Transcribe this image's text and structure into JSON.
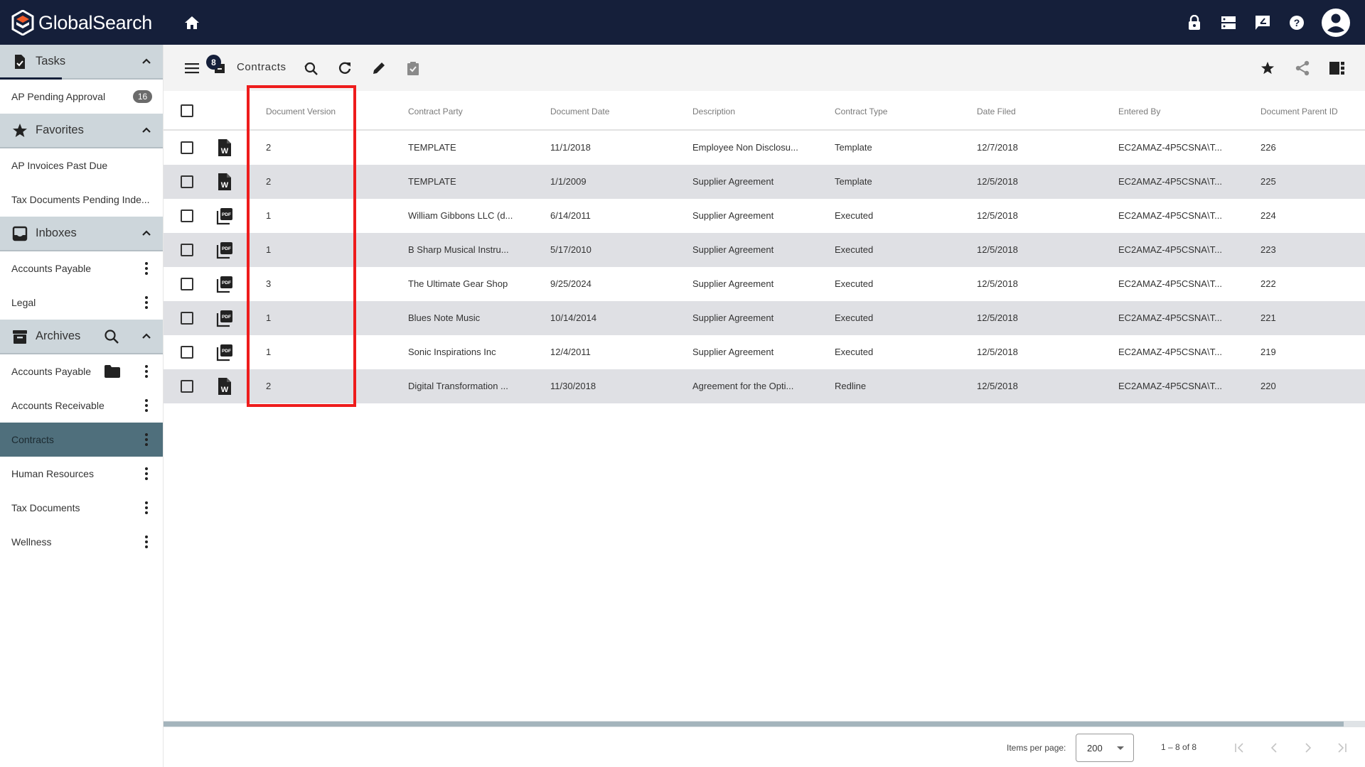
{
  "app": {
    "title": "GlobalSearch",
    "brand_color": "#151f3a",
    "accent_color": "#f05a28"
  },
  "topbar": {
    "icons": [
      "home-icon",
      "lock-icon",
      "server-icon",
      "feedback-icon",
      "help-icon",
      "account-icon"
    ]
  },
  "sidebar": {
    "sections": [
      {
        "label": "Tasks",
        "icon": "task-icon",
        "items": [
          {
            "label": "AP Pending Approval",
            "badge": "16"
          }
        ]
      },
      {
        "label": "Favorites",
        "icon": "star-icon",
        "items": [
          {
            "label": "AP Invoices Past Due"
          },
          {
            "label": "Tax Documents Pending Inde..."
          }
        ]
      },
      {
        "label": "Inboxes",
        "icon": "inbox-icon",
        "items": [
          {
            "label": "Accounts Payable"
          },
          {
            "label": "Legal"
          }
        ]
      },
      {
        "label": "Archives",
        "icon": "archive-icon",
        "items": [
          {
            "label": "Accounts Payable"
          },
          {
            "label": "Accounts Receivable"
          },
          {
            "label": "Contracts",
            "selected": true
          },
          {
            "label": "Human Resources"
          },
          {
            "label": "Tax Documents"
          },
          {
            "label": "Wellness"
          }
        ]
      }
    ]
  },
  "toolbar": {
    "title": "Contracts",
    "count_badge": "8",
    "icons": [
      "menu-icon",
      "archive-count-icon",
      "search-refresh-icon",
      "refresh-icon",
      "edit-icon",
      "approve-icon",
      "favorite-star-icon",
      "share-icon",
      "view-columns-icon"
    ]
  },
  "table": {
    "columns": [
      "Document Version",
      "Contract Party",
      "Document Date",
      "Description",
      "Contract Type",
      "Date Filed",
      "Entered By",
      "Document Parent ID"
    ],
    "rows": [
      {
        "file_type": "word",
        "version": "2",
        "party": "TEMPLATE",
        "doc_date": "11/1/2018",
        "description": "Employee Non Disclosu...",
        "type": "Template",
        "date_filed": "12/7/2018",
        "entered_by": "EC2AMAZ-4P5CSNA\\T...",
        "parent_id": "226"
      },
      {
        "file_type": "word",
        "version": "2",
        "party": "TEMPLATE",
        "doc_date": "1/1/2009",
        "description": "Supplier Agreement",
        "type": "Template",
        "date_filed": "12/5/2018",
        "entered_by": "EC2AMAZ-4P5CSNA\\T...",
        "parent_id": "225"
      },
      {
        "file_type": "pdf",
        "version": "1",
        "party": "William Gibbons LLC (d...",
        "doc_date": "6/14/2011",
        "description": "Supplier Agreement",
        "type": "Executed",
        "date_filed": "12/5/2018",
        "entered_by": "EC2AMAZ-4P5CSNA\\T...",
        "parent_id": "224"
      },
      {
        "file_type": "pdf",
        "version": "1",
        "party": "B Sharp Musical Instru...",
        "doc_date": "5/17/2010",
        "description": "Supplier Agreement",
        "type": "Executed",
        "date_filed": "12/5/2018",
        "entered_by": "EC2AMAZ-4P5CSNA\\T...",
        "parent_id": "223"
      },
      {
        "file_type": "pdf",
        "version": "3",
        "party": "The Ultimate Gear Shop",
        "doc_date": "9/25/2024",
        "description": "Supplier Agreement",
        "type": "Executed",
        "date_filed": "12/5/2018",
        "entered_by": "EC2AMAZ-4P5CSNA\\T...",
        "parent_id": "222"
      },
      {
        "file_type": "pdf",
        "version": "1",
        "party": "Blues Note Music",
        "doc_date": "10/14/2014",
        "description": "Supplier Agreement",
        "type": "Executed",
        "date_filed": "12/5/2018",
        "entered_by": "EC2AMAZ-4P5CSNA\\T...",
        "parent_id": "221"
      },
      {
        "file_type": "pdf",
        "version": "1",
        "party": "Sonic Inspirations Inc",
        "doc_date": "12/4/2011",
        "description": "Supplier Agreement",
        "type": "Executed",
        "date_filed": "12/5/2018",
        "entered_by": "EC2AMAZ-4P5CSNA\\T...",
        "parent_id": "219"
      },
      {
        "file_type": "word",
        "version": "2",
        "party": "Digital Transformation ...",
        "doc_date": "11/30/2018",
        "description": "Agreement for the Opti...",
        "type": "Redline",
        "date_filed": "12/5/2018",
        "entered_by": "EC2AMAZ-4P5CSNA\\T...",
        "parent_id": "220"
      }
    ]
  },
  "highlight": {
    "target": "Document Version column",
    "color": "#ee1c1c"
  },
  "paginator": {
    "items_per_page_label": "Items per page:",
    "items_per_page": "200",
    "range_label": "1 – 8 of 8"
  }
}
